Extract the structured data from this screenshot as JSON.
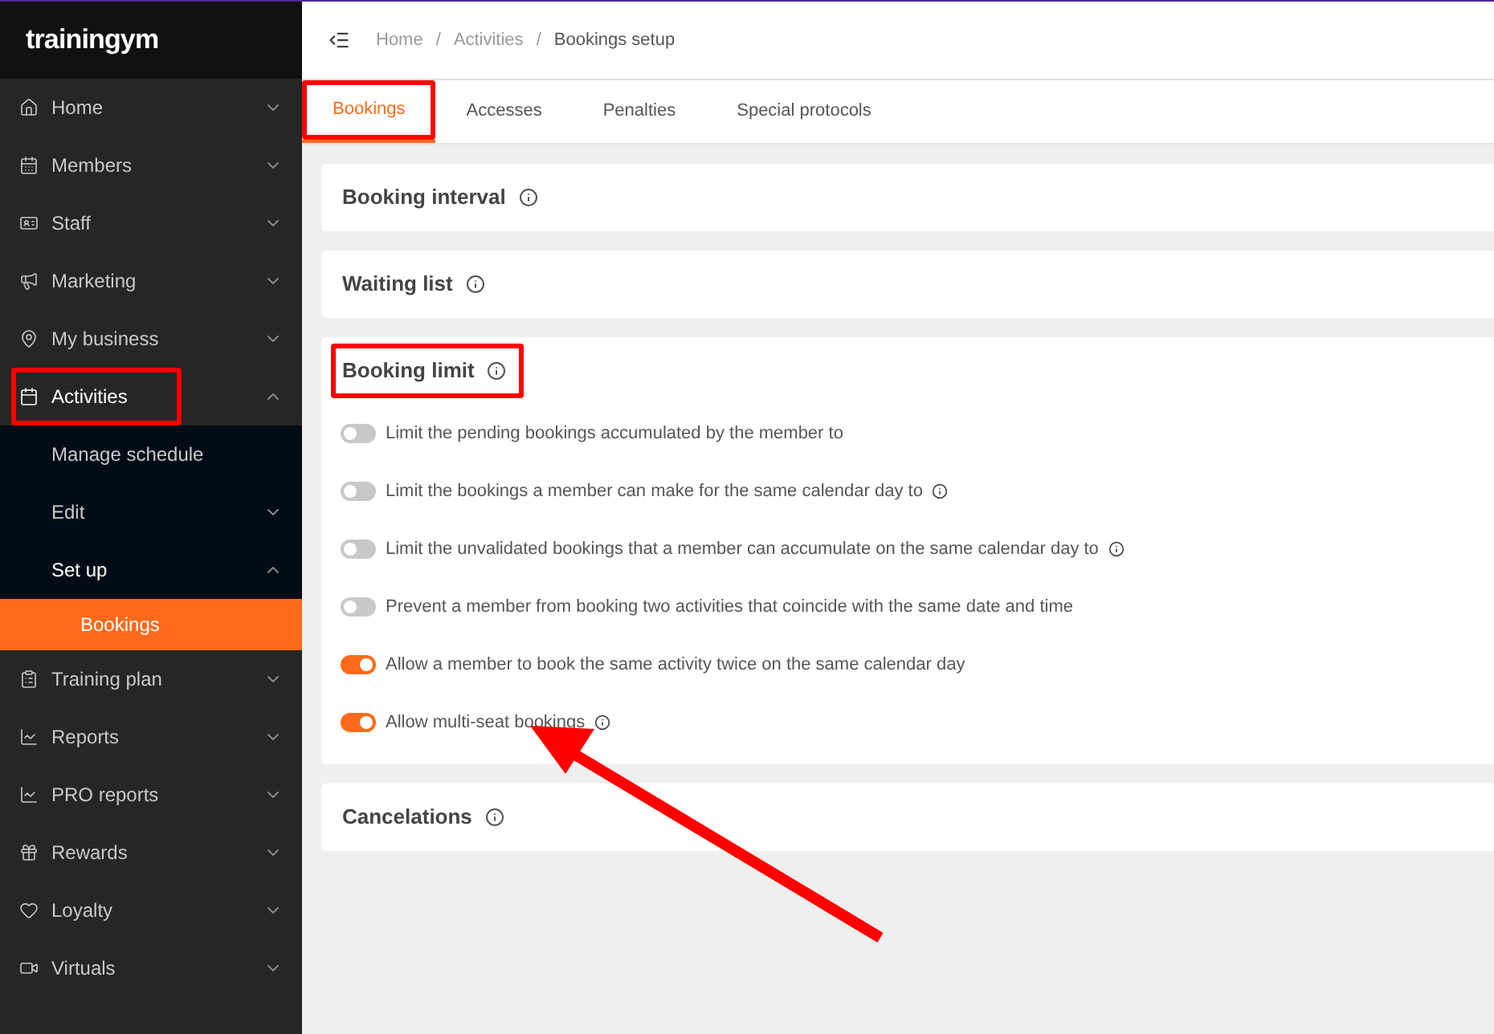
{
  "logo": "trainingym",
  "sidebar": {
    "items": [
      {
        "label": "Home",
        "expanded": false
      },
      {
        "label": "Members",
        "expanded": false
      },
      {
        "label": "Staff",
        "expanded": false
      },
      {
        "label": "Marketing",
        "expanded": false
      },
      {
        "label": "My business",
        "expanded": false
      },
      {
        "label": "Activities",
        "expanded": true,
        "highlighted": true,
        "children": [
          {
            "label": "Manage schedule",
            "has_caret": false,
            "expanded": false,
            "selected": false
          },
          {
            "label": "Edit",
            "has_caret": true,
            "expanded": false,
            "selected": false
          },
          {
            "label": "Set up",
            "has_caret": true,
            "expanded": true,
            "selected": false,
            "children": [
              {
                "label": "Bookings",
                "selected": true
              }
            ]
          }
        ]
      },
      {
        "label": "Training plan",
        "expanded": false
      },
      {
        "label": "Reports",
        "expanded": false
      },
      {
        "label": "PRO reports",
        "expanded": false
      },
      {
        "label": "Rewards",
        "expanded": false
      },
      {
        "label": "Loyalty",
        "expanded": false
      },
      {
        "label": "Virtuals",
        "expanded": false
      }
    ]
  },
  "breadcrumb": {
    "separator": "/",
    "items": [
      "Home",
      "Activities",
      "Bookings setup"
    ]
  },
  "tabs": [
    {
      "label": "Bookings",
      "selected": true,
      "highlighted": true
    },
    {
      "label": "Accesses",
      "selected": false,
      "highlighted": false
    },
    {
      "label": "Penalties",
      "selected": false,
      "highlighted": false
    },
    {
      "label": "Special protocols",
      "selected": false,
      "highlighted": false
    }
  ],
  "sections": [
    {
      "title": "Booking interval",
      "highlighted": false
    },
    {
      "title": "Waiting list",
      "highlighted": false
    },
    {
      "title": "Booking limit",
      "highlighted": true,
      "settings": [
        {
          "label": "Limit the pending bookings accumulated by the member to",
          "on": false,
          "info": false,
          "arrow": false
        },
        {
          "label": "Limit the bookings a member can make for the same calendar day to",
          "on": false,
          "info": true,
          "arrow": false
        },
        {
          "label": "Limit the unvalidated bookings that a member can accumulate on the same calendar day to",
          "on": false,
          "info": true,
          "arrow": false
        },
        {
          "label": "Prevent a member from booking two activities that coincide with the same date and time",
          "on": false,
          "info": false,
          "arrow": false
        },
        {
          "label": "Allow a member to book the same activity twice on the same calendar day",
          "on": true,
          "info": false,
          "arrow": false
        },
        {
          "label": "Allow multi-seat bookings",
          "on": true,
          "info": true,
          "arrow": true
        }
      ]
    },
    {
      "title": "Cancelations",
      "highlighted": false
    }
  ]
}
